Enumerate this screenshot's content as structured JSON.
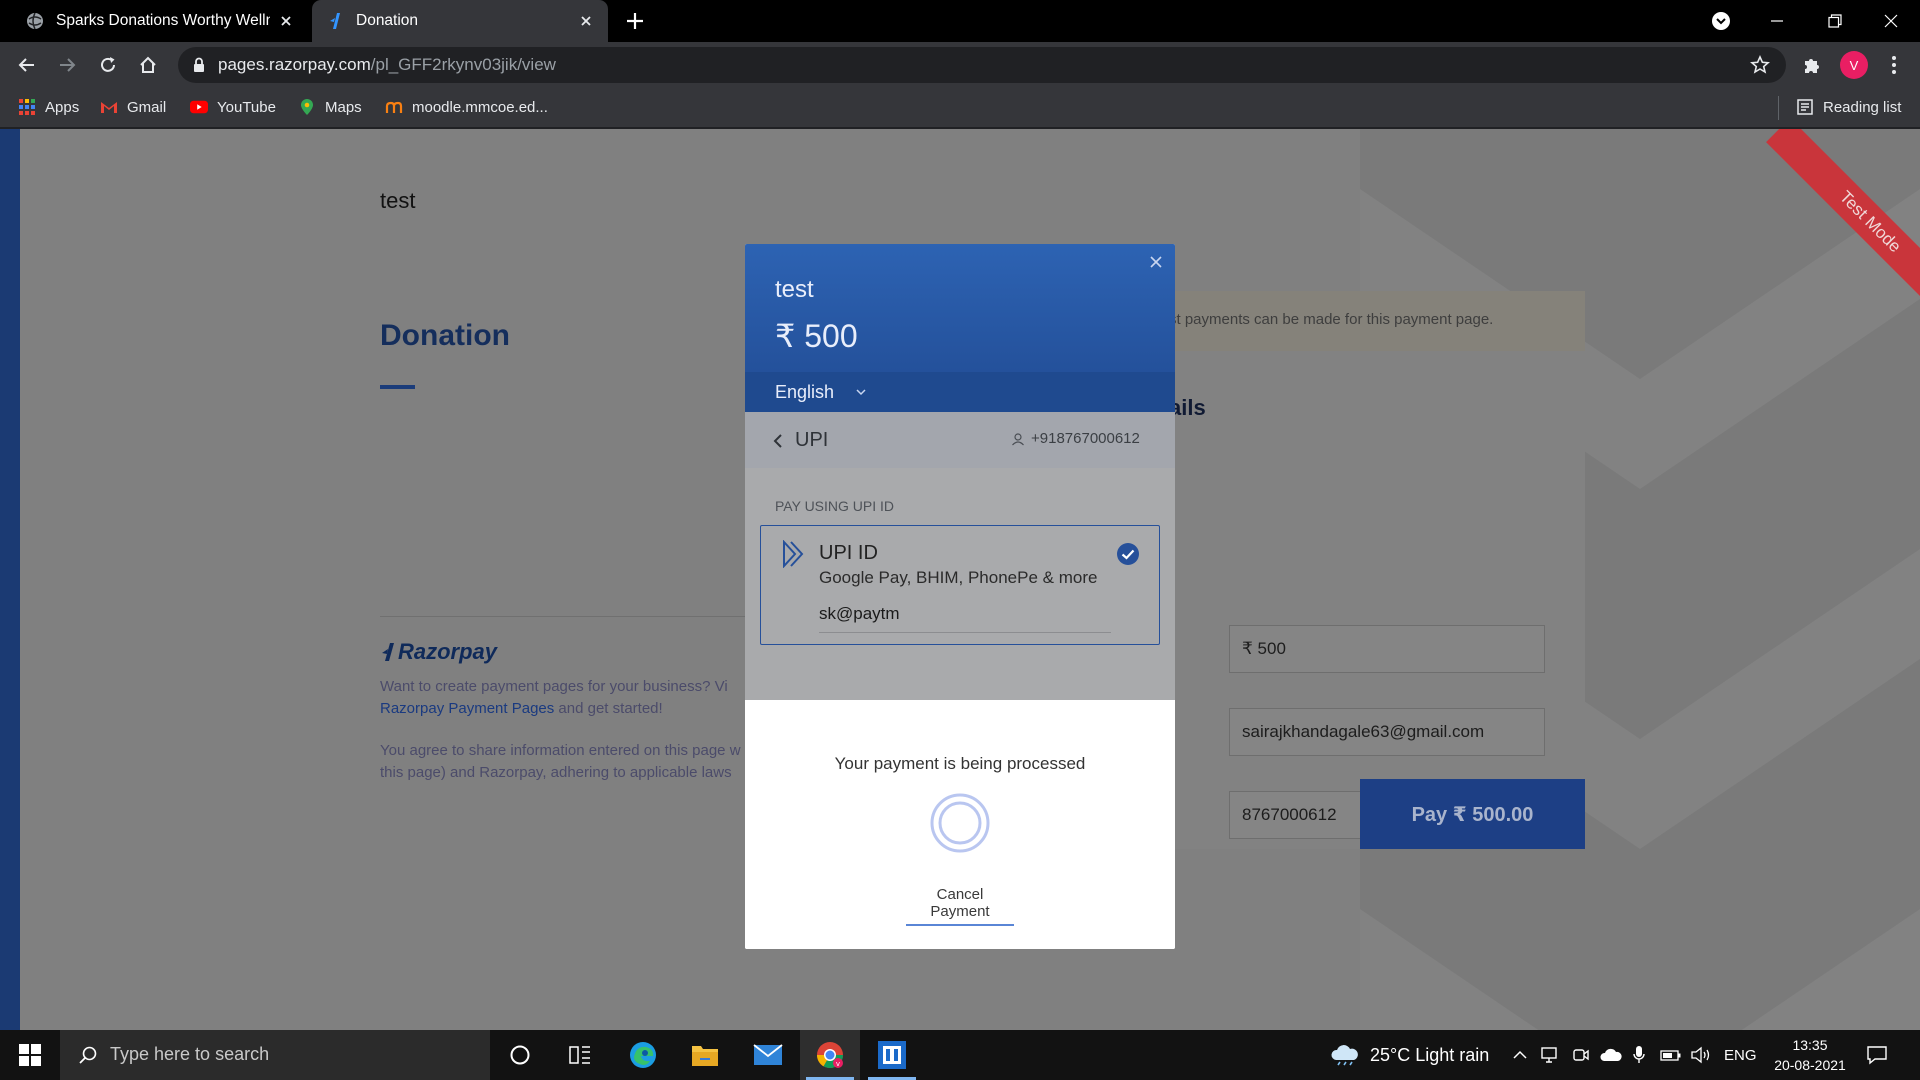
{
  "browser": {
    "tabs": [
      {
        "title": "Sparks Donations Worthy Wellne",
        "active": false
      },
      {
        "title": "Donation",
        "active": true
      }
    ],
    "url_host": "pages.razorpay.com",
    "url_path": "/pl_GFF2rkynv03jik/view",
    "profile_initial": "V",
    "bookmarks": [
      {
        "label": "Apps",
        "icon": "apps-grid-icon"
      },
      {
        "label": "Gmail",
        "icon": "gmail-icon"
      },
      {
        "label": "YouTube",
        "icon": "youtube-icon"
      },
      {
        "label": "Maps",
        "icon": "maps-icon"
      },
      {
        "label": "moodle.mmcoe.ed...",
        "icon": "moodle-icon"
      }
    ],
    "reading_list": "Reading list"
  },
  "page": {
    "merchant": "test",
    "heading": "Donation",
    "razorpay_brand": "Razorpay",
    "footer_line1_a": "Want to create payment pages for your business? Vi",
    "footer_line2_link": "Razorpay Payment Pages",
    "footer_line2_b": " and get started!",
    "footer_line3": "You agree to share information entered on this page w",
    "footer_line4": "this page) and Razorpay, adhering to applicable laws",
    "test_notice": "st payments can be made for this payment page.",
    "details_title": "ails",
    "fields": {
      "amount": "₹ 500",
      "email": "sairajkhandagale63@gmail.com",
      "phone": "8767000612"
    },
    "pay_button": "Pay  ₹ 500.00",
    "ribbon": "Test Mode",
    "colors": {
      "ribbon": "#c9353b",
      "brand_blue": "#24519b"
    }
  },
  "checkout": {
    "merchant": "test",
    "amount": "₹ 500",
    "language": "English",
    "method_title": "UPI",
    "contact": "+918767000612",
    "section_label": "PAY USING UPI ID",
    "upi_option_title": "UPI ID",
    "upi_option_sub": "Google Pay, BHIM, PhonePe & more",
    "upi_id_value": "sk@paytm",
    "processing_text": "Your payment is being processed",
    "cancel_label": "Cancel Payment"
  },
  "taskbar": {
    "search_placeholder": "Type here to search",
    "weather": "25°C  Light rain",
    "language": "ENG",
    "time": "13:35",
    "date": "20-08-2021"
  }
}
